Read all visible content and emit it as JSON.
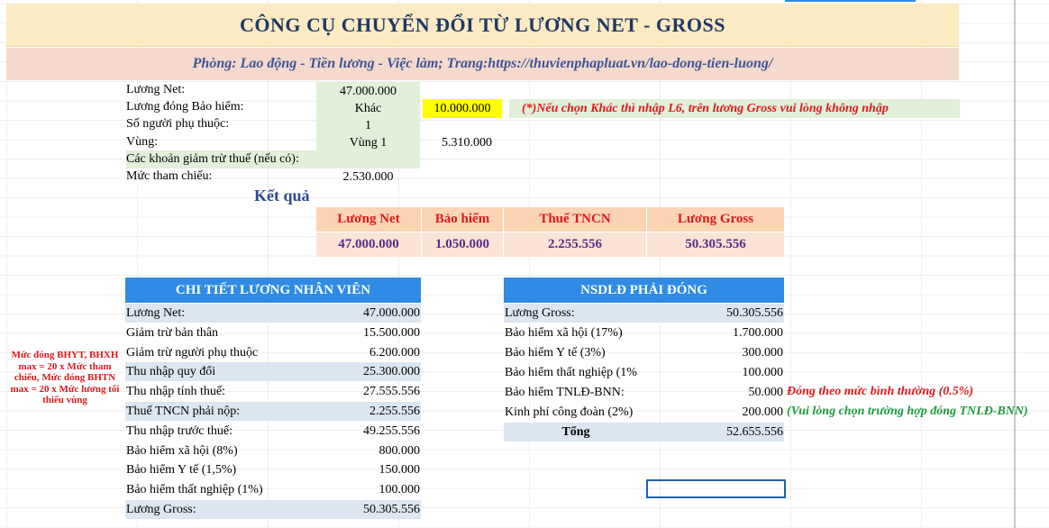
{
  "title": "CÔNG CỤ CHUYỂN ĐỔI TỪ LƯƠNG NET - GROSS",
  "subtitle": "Phòng: Lao động - Tiền lương - Việc làm; Trang:https://thuvienphapluat.vn/lao-dong-tien-luong/",
  "inputs": {
    "net_label": "Lương Net:",
    "net_value": "47.000.000",
    "insurance_label": "Lương đóng Bảo hiểm:",
    "insurance_option": "Khác",
    "insurance_amount": "10.000.000",
    "insurance_note": "(*)Nếu chọn Khác thì nhập L6, trên lương Gross vui lòng không nhập",
    "dependents_label": "Số người phụ thuộc:",
    "dependents_value": "1",
    "region_label": "Vùng:",
    "region_value": "Vùng 1",
    "region_min_wage": "5.310.000",
    "deductions_label": "Các khoản giảm trừ thuế (nếu có):",
    "deductions_value": "",
    "reference_label": "Mức tham chiếu:",
    "reference_value": "2.530.000"
  },
  "result": {
    "heading": "Kết quả",
    "columns": [
      "Lương Net",
      "Bảo hiểm",
      "Thuế TNCN",
      "Lương Gross"
    ],
    "values": [
      "47.000.000",
      "1.050.000",
      "2.255.556",
      "50.305.556"
    ]
  },
  "side_note": "Mức đóng BHYT, BHXH max = 20 x Mức tham chiếu, Mức đóng BHTN max = 20 x Mức lương tối thiểu vùng",
  "employee": {
    "header": "CHI TIẾT LƯƠNG NHÂN VIÊN",
    "rows": [
      {
        "label": "Lương Net:",
        "value": "47.000.000"
      },
      {
        "label": "Giảm trừ bản thân",
        "value": "15.500.000"
      },
      {
        "label": "Giảm trừ người phụ thuộc",
        "value": "6.200.000"
      },
      {
        "label": "Thu nhập quy đổi",
        "value": "25.300.000"
      },
      {
        "label": "Thu nhập tính thuế:",
        "value": "27.555.556"
      },
      {
        "label": "Thuế TNCN phải nộp:",
        "value": "2.255.556"
      },
      {
        "label": "Thu nhập trước thuế:",
        "value": "49.255.556"
      },
      {
        "label": "Bảo hiểm xã hội (8%)",
        "value": "800.000"
      },
      {
        "label": "Bảo hiểm Y tế (1,5%)",
        "value": "150.000"
      },
      {
        "label": "Bảo hiểm thất nghiệp (1%)",
        "value": "100.000"
      },
      {
        "label": "Lương Gross:",
        "value": "50.305.556"
      }
    ]
  },
  "employer": {
    "header": "NSDLĐ PHẢI ĐÓNG",
    "rows": [
      {
        "label": "Lương Gross:",
        "value": "50.305.556"
      },
      {
        "label": "Bảo hiểm xã hội (17%)",
        "value": "1.700.000"
      },
      {
        "label": "Bảo hiểm Y tế (3%)",
        "value": "300.000"
      },
      {
        "label": "Bảo hiểm thất nghiệp (1%",
        "value": "100.000"
      },
      {
        "label": "Bảo hiểm TNLĐ-BNN:",
        "value": "50.000"
      },
      {
        "label": "Kinh phí công đoàn (2%)",
        "value": "200.000"
      },
      {
        "label": "Tổng",
        "value": "52.655.556"
      }
    ],
    "tnld_note": "Đóng theo mức bình thường (0.5%)",
    "union_note": "(Vui lòng chọn trường hợp đóng TNLĐ-BNN)"
  },
  "colors": {
    "title_bg": "#fcebc3",
    "subtitle_bg": "#f4d9cc",
    "header_blue": "#2f8be3",
    "light_blue": "#dce6f1",
    "input_green": "#e2efd9",
    "input_yellow": "#ffff00",
    "result_header": "#fbd4b4",
    "result_value": "#fbe4d5"
  }
}
